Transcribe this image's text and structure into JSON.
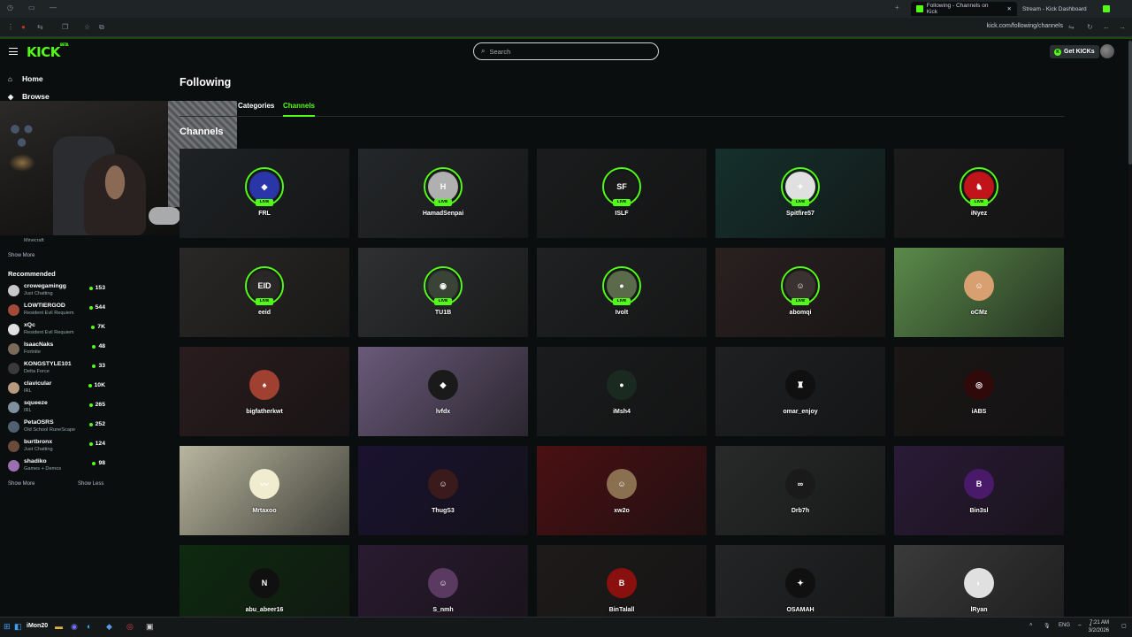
{
  "browser": {
    "tabs": [
      {
        "title": "Following - Channels on Kick",
        "active": true
      },
      {
        "title": "Stream - Kick Dashboard",
        "active": false
      }
    ],
    "url": "kick.com/following/channels"
  },
  "header": {
    "logo": "KICK",
    "logo_sup": "BETA",
    "search_placeholder": "Search",
    "get_kicks_label": "Get KICKs"
  },
  "sidebar": {
    "nav": [
      {
        "label": "Home",
        "icon": "home-icon"
      },
      {
        "label": "Browse",
        "icon": "compass-icon"
      }
    ],
    "following_partial": {
      "category": "Minecraft"
    },
    "show_more_following": "Show More",
    "recommended_heading": "Recommended",
    "recommended": [
      {
        "name": "crowegamingg",
        "category": "Just Chatting",
        "viewers": "153",
        "color": "#c8c8c8"
      },
      {
        "name": "LOWTIERGOD",
        "category": "Resident Evil Requiem",
        "viewers": "544",
        "color": "#a04a3a"
      },
      {
        "name": "xQc",
        "category": "Resident Evil Requiem",
        "viewers": "7K",
        "color": "#e0e0e0"
      },
      {
        "name": "IsaacNaks",
        "category": "Fortnite",
        "viewers": "48",
        "color": "#7a6a5a"
      },
      {
        "name": "KONGSTYLE101",
        "category": "Delta Force",
        "viewers": "33",
        "color": "#3a3a3a"
      },
      {
        "name": "clavicular",
        "category": "IRL",
        "viewers": "10K",
        "color": "#b89a80"
      },
      {
        "name": "squeeze",
        "category": "IRL",
        "viewers": "265",
        "color": "#8090a0"
      },
      {
        "name": "PetaOSRS",
        "category": "Old School RuneScape",
        "viewers": "252",
        "color": "#506070"
      },
      {
        "name": "burtbronx",
        "category": "Just Chatting",
        "viewers": "124",
        "color": "#6a4a3a"
      },
      {
        "name": "shadiko",
        "category": "Games + Demos",
        "viewers": "98",
        "color": "#9a70b0"
      }
    ],
    "show_more": "Show More",
    "show_less": "Show Less"
  },
  "main": {
    "title": "Following",
    "tabs": [
      {
        "label": "Categories",
        "active": false
      },
      {
        "label": "Channels",
        "active": true
      }
    ],
    "section_title": "Channels",
    "live_label": "LIVE",
    "channels": [
      {
        "name": "FRL",
        "live": true,
        "bg": "#1e2224",
        "av": "#2a36a8",
        "glyph": "◆"
      },
      {
        "name": "HamadSenpai",
        "live": true,
        "bg": "#242729",
        "av": "#b0b0b0",
        "glyph": "H"
      },
      {
        "name": "ISLF",
        "live": true,
        "bg": "#1a1c1d",
        "av": "#1a1a1a",
        "glyph": "SF"
      },
      {
        "name": "Spitfire57",
        "live": true,
        "bg": "#15302c",
        "av": "#e0e0e0",
        "glyph": "✦"
      },
      {
        "name": "iNyez",
        "live": true,
        "bg": "#1b1b1b",
        "av": "#c0141a",
        "glyph": "♞"
      },
      {
        "name": "eeid",
        "live": true,
        "bg": "#2a2826",
        "av": "#2a2826",
        "glyph": "EID"
      },
      {
        "name": "TU1B",
        "live": true,
        "bg": "#2e3031",
        "av": "#3a4436",
        "glyph": "◉"
      },
      {
        "name": "Ivolt",
        "live": true,
        "bg": "#1f2122",
        "av": "#5a6a4a",
        "glyph": "●"
      },
      {
        "name": "abomqi",
        "live": true,
        "bg": "#2a2020",
        "av": "#3a3230",
        "glyph": "☺"
      },
      {
        "name": "oCMz",
        "live": false,
        "bg": "#5a8a4a",
        "av": "#d8a070",
        "glyph": "☺"
      },
      {
        "name": "bigfatherkwt",
        "live": false,
        "bg": "#2a1c1e",
        "av": "#a04030",
        "glyph": "♠"
      },
      {
        "name": "lvfdx",
        "live": false,
        "bg": "#6a5a7a",
        "av": "#1a1a1a",
        "glyph": "◆"
      },
      {
        "name": "iMsh4",
        "live": false,
        "bg": "#1a1c1d",
        "av": "#1a2a20",
        "glyph": "●"
      },
      {
        "name": "omar_enjoy",
        "live": false,
        "bg": "#1e2022",
        "av": "#101010",
        "glyph": "♜"
      },
      {
        "name": "iABS",
        "live": false,
        "bg": "#1a1616",
        "av": "#300a0a",
        "glyph": "◎"
      },
      {
        "name": "Mrtaxoo",
        "live": false,
        "bg": "#b8b69e",
        "av": "#f0ecd0",
        "glyph": "〰"
      },
      {
        "name": "ThugS3",
        "live": false,
        "bg": "#1a1230",
        "av": "#3a1a1a",
        "glyph": "☺"
      },
      {
        "name": "xw2o",
        "live": false,
        "bg": "#4a1012",
        "av": "#8a7050",
        "glyph": "☺"
      },
      {
        "name": "Drb7h",
        "live": false,
        "bg": "#282a2a",
        "av": "#1a1a1a",
        "glyph": "∞"
      },
      {
        "name": "Bin3sl",
        "live": false,
        "bg": "#2a1a36",
        "av": "#4a1a6a",
        "glyph": "B"
      },
      {
        "name": "abu_abeer16",
        "live": false,
        "bg": "#0e2a10",
        "av": "#101010",
        "glyph": "N"
      },
      {
        "name": "S_nmh",
        "live": false,
        "bg": "#2a1a30",
        "av": "#5a3a60",
        "glyph": "☺"
      },
      {
        "name": "BinTalall",
        "live": false,
        "bg": "#1e1a1a",
        "av": "#8a1010",
        "glyph": "B"
      },
      {
        "name": "OSAMAH",
        "live": false,
        "bg": "#232526",
        "av": "#101010",
        "glyph": "✦"
      },
      {
        "name": "lRyan",
        "live": false,
        "bg": "#3a3a3a",
        "av": "#e0e0e0",
        "glyph": "◐"
      }
    ]
  },
  "taskbar": {
    "username": "iMon20",
    "language": "ENG",
    "time": "7:21 AM",
    "date": "3/2/2026"
  },
  "colors": {
    "accent": "#53fc18",
    "background": "#0b0e0f",
    "card": "#1c1f21"
  }
}
